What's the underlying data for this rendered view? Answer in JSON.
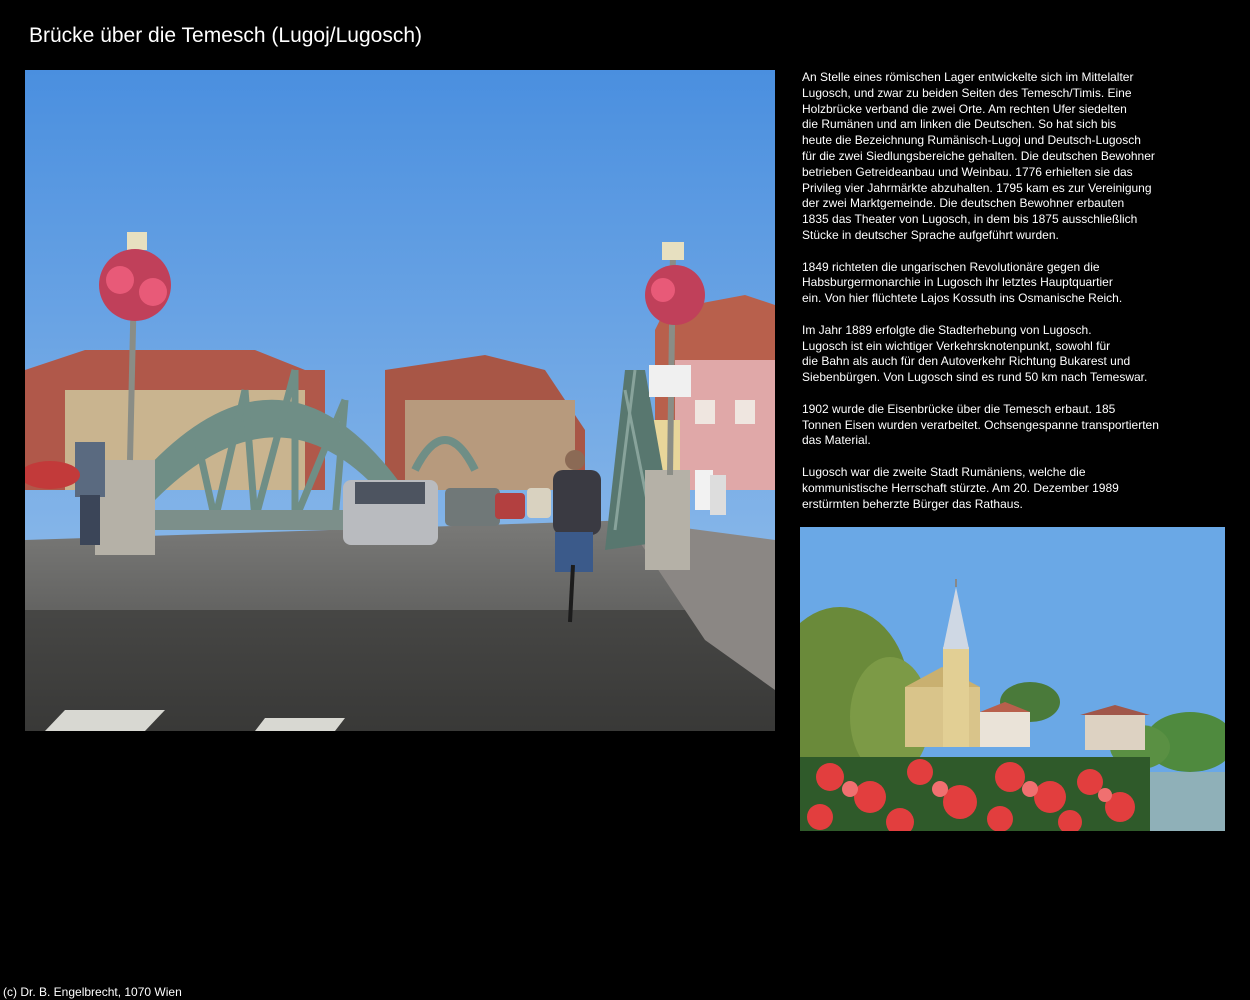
{
  "page": {
    "title": "Brücke über die Temesch (Lugoj/Lugosch)"
  },
  "text": {
    "paragraphs": [
      "An Stelle eines römischen Lager entwickelte sich im Mittelalter\nLugosch, und zwar zu beiden Seiten des Temesch/Timis. Eine\nHolzbrücke verband die zwei Orte. Am rechten Ufer siedelten\ndie Rumänen und am linken die Deutschen. So hat sich bis\nheute die Bezeichnung Rumänisch-Lugoj und Deutsch-Lugosch\nfür die zwei Siedlungsbereiche gehalten. Die deutschen Bewohner\nbetrieben Getreideanbau und Weinbau. 1776 erhielten sie das\nPrivileg vier Jahrmärkte abzuhalten. 1795 kam es zur Vereinigung\nder zwei Marktgemeinde. Die deutschen Bewohner erbauten\n1835 das Theater von Lugosch, in dem bis 1875 ausschließlich\nStücke in deutscher Sprache aufgeführt wurden.",
      "1849 richteten die ungarischen Revolutionäre gegen die\nHabsburgermonarchie in Lugosch ihr letztes Hauptquartier\nein. Von hier flüchtete Lajos Kossuth ins Osmanische Reich.",
      "Im Jahr 1889 erfolgte die Stadterhebung von Lugosch.\nLugosch ist ein wichtiger Verkehrsknotenpunkt, sowohl für\ndie Bahn als auch für den Autoverkehr Richtung Bukarest und\nSiebenbürgen. Von Lugosch sind es rund 50 km nach Temeswar.",
      "1902 wurde die Eisenbrücke über die Temesch erbaut. 185\nTonnen Eisen wurden verarbeitet. Ochsengespanne transportierten\ndas Material.",
      "Lugosch war die zweite Stadt Rumäniens, welche die\nkommunistische Herrschaft stürzte. Am 20. Dezember 1989\nerstürmten beherzte Bürger das Rathaus."
    ]
  },
  "footer": {
    "copyright": "(c) Dr. B. Engelbrecht, 1070 Wien"
  },
  "colors": {
    "background": "#000000",
    "text": "#ffffff",
    "sky": "#5a9be0",
    "bridge": "#6f8e86"
  }
}
